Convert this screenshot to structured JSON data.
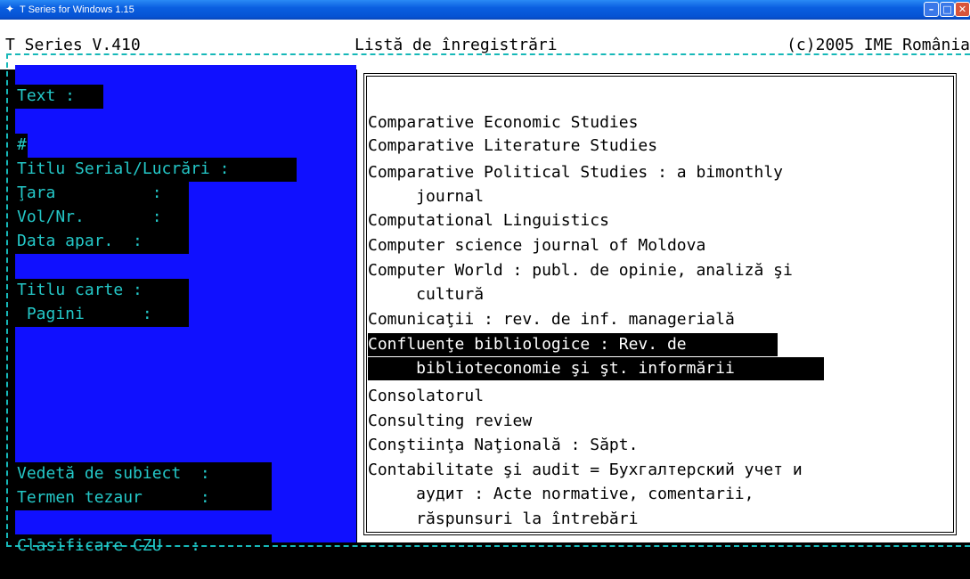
{
  "window": {
    "title": "T Series for Windows 1.15"
  },
  "header": {
    "left": "T Series V.410",
    "center": "Listă de înregistrări",
    "right": "(c)2005 IME România"
  },
  "colors": {
    "panel": "#1010ff",
    "label_text": "#24c8c8",
    "frame": "#16b8b8"
  },
  "search_fields": [
    {
      "label": "Text :"
    },
    {
      "label": "#"
    },
    {
      "label": "Titlu Serial/Lucrări :"
    },
    {
      "label": "Ţara          :"
    },
    {
      "label": "Vol/Nr.       :"
    },
    {
      "label": "Data apar.  :"
    },
    {
      "label": "Titlu carte :"
    },
    {
      "label": " Pagini      :"
    },
    {
      "label": "Vedetă de subiect  :"
    },
    {
      "label": "Termen tezaur      :"
    },
    {
      "label": "Clasificare CZU   :"
    }
  ],
  "list": {
    "selected_index": 8,
    "rows": [
      "Comparative Economic Studies",
      "Comparative Literature Studies",
      "Comparative Political Studies : a bimonthly",
      "     journal",
      "Computational Linguistics",
      "Computer science journal of Moldova",
      "Computer World : publ. de opinie, analiză şi",
      "     cultură",
      "Comunicaţii : rev. de inf. managerială",
      "Confluenţe bibliologice : Rev. de",
      "     biblioteconomie şi şt. informării",
      "Consolatorul",
      "Consulting review",
      "Conştiinţa Naţională : Săpt.",
      "Contabilitate şi audit = Бухгалтерский учет и",
      "     аудит : Acte normative, comentarii,",
      "     răspunsuri la întrebări"
    ]
  }
}
